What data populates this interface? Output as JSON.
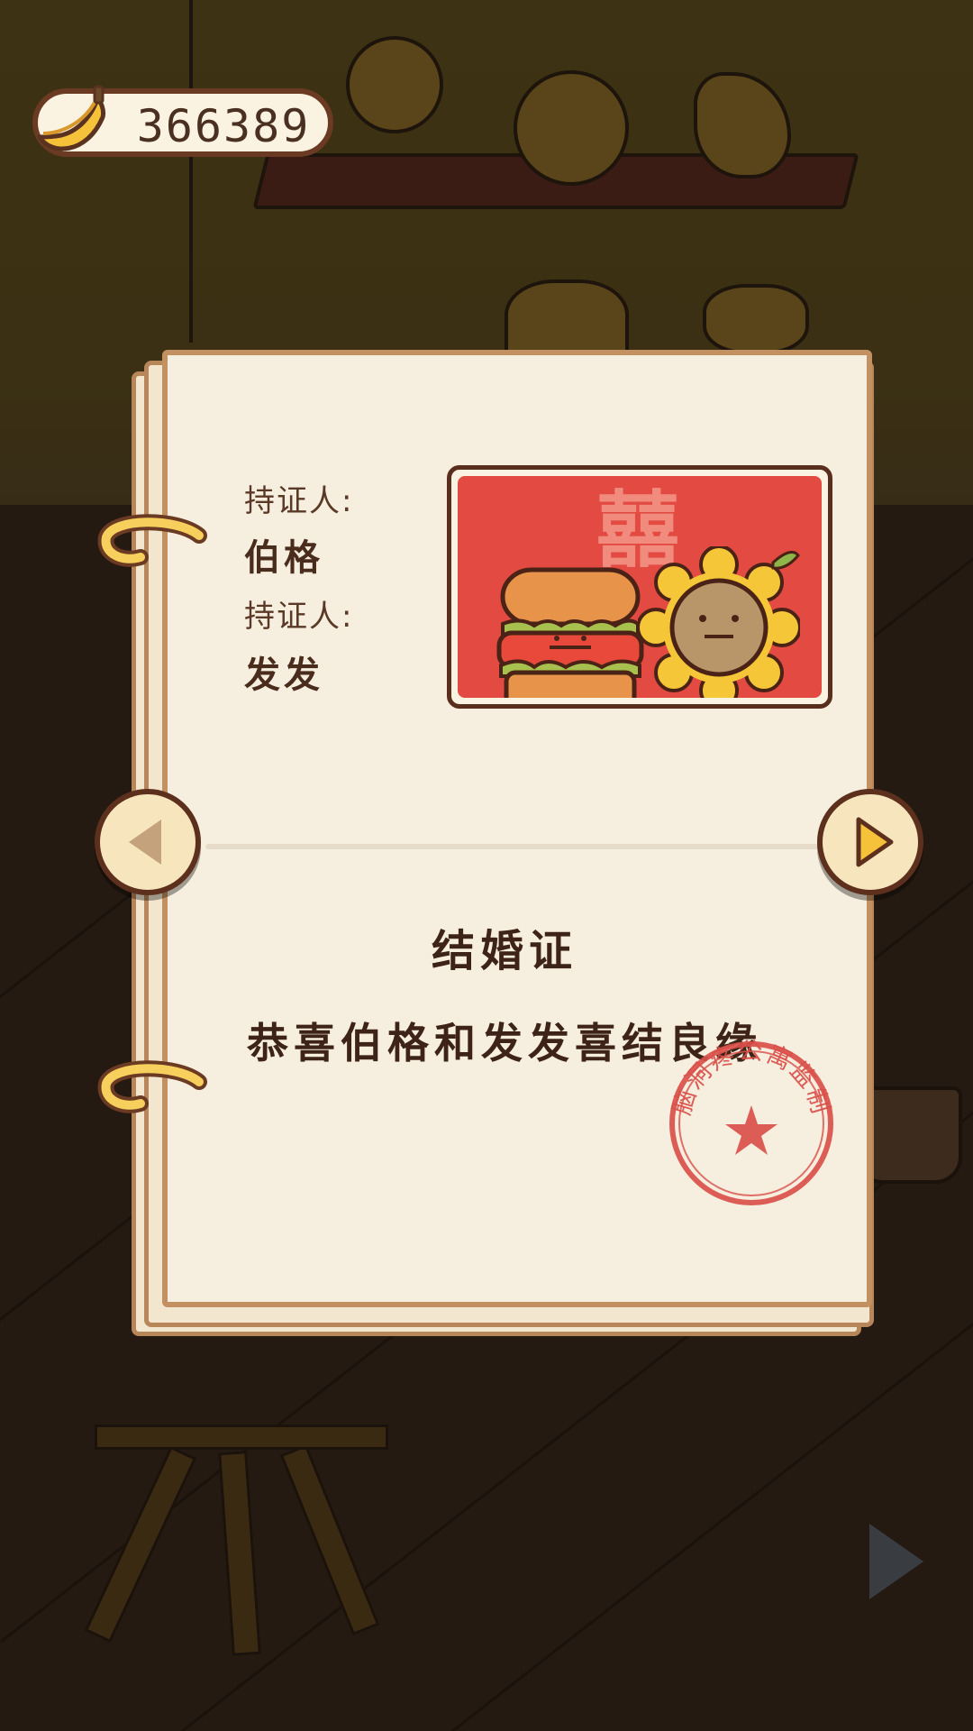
{
  "hud": {
    "banana_count": "366389",
    "currency_icon": "banana-icon"
  },
  "certificate": {
    "holder_1_label": "持证人:",
    "holder_1_name": "伯格",
    "holder_2_label": "持证人:",
    "holder_2_name": "发发",
    "photo_caption": "囍",
    "title": "结婚证",
    "message": "恭喜伯格和发发喜结良缘",
    "stamp_text": "脑洞疼公寓监制"
  },
  "navigation": {
    "prev_icon": "triangle-left-icon",
    "next_icon": "triangle-right-icon"
  },
  "colors": {
    "page": "#f6efdf",
    "page_border": "#c39062",
    "photo_background": "#e24a42",
    "stamp_red": "#d9504a",
    "button_fill": "#f7e6bd",
    "text_dark": "#3e2418"
  }
}
